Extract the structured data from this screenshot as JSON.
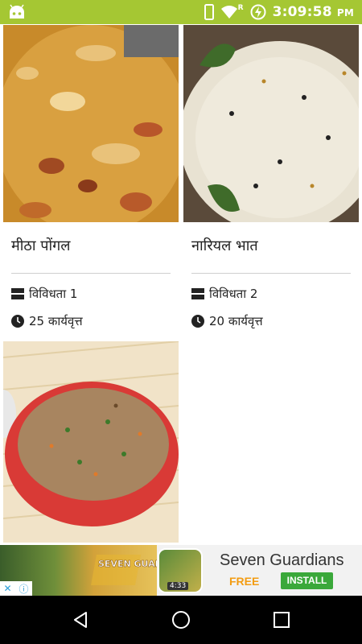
{
  "status_bar": {
    "time": "3:09:58",
    "ampm": "PM",
    "icons": [
      "android-debug-icon",
      "phone-icon",
      "wifi-icon",
      "roaming-icon",
      "battery-charging-icon"
    ],
    "roaming_label": "R",
    "color": "#a5c733"
  },
  "recipes": [
    {
      "title": "मीठा पोंगल",
      "difficulty": "विविधता 1",
      "time": "25 कार्यवृत्त",
      "image": "sweet-pongal-photo"
    },
    {
      "title": "नारियल भात",
      "difficulty": "विविधता 2",
      "time": "20 कार्यवृत्त",
      "image": "coconut-rice-photo"
    },
    {
      "image": "fried-rice-photo"
    }
  ],
  "ad": {
    "title": "Seven Guardians",
    "free_label": "FREE",
    "install_label": "INSTALL",
    "art_text": "SEVEN GUARDIANS",
    "icon_badge": "4:33",
    "accent_free": "#f39c12",
    "accent_install": "#3aa83a"
  },
  "nav_bar": {
    "buttons": [
      "back-button",
      "home-button",
      "recents-button"
    ]
  }
}
